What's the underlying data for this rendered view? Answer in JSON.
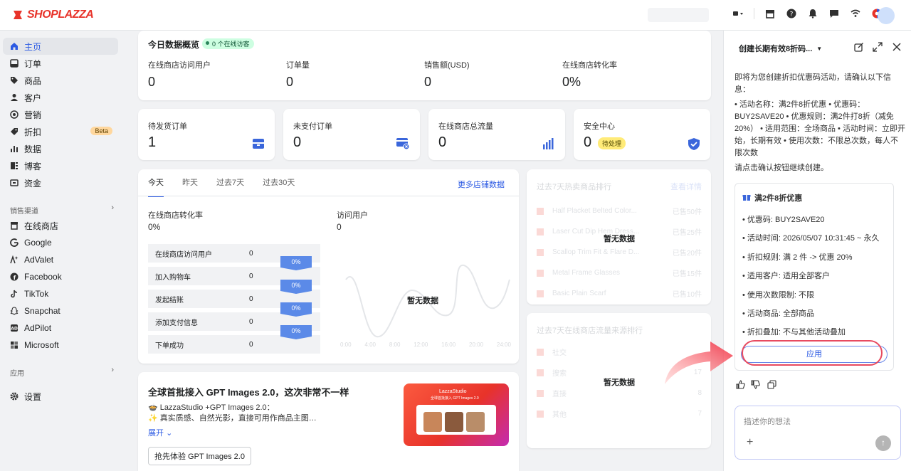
{
  "brand": {
    "name": "SHOPLAZZA"
  },
  "nav": {
    "items": [
      {
        "label": "主页"
      },
      {
        "label": "订单"
      },
      {
        "label": "商品"
      },
      {
        "label": "客户"
      },
      {
        "label": "营销"
      },
      {
        "label": "折扣",
        "badge": "Beta"
      },
      {
        "label": "数据"
      },
      {
        "label": "博客"
      },
      {
        "label": "资金"
      }
    ],
    "channels_label": "销售渠道",
    "channels": [
      {
        "label": "在线商店"
      },
      {
        "label": "Google"
      },
      {
        "label": "AdValet"
      },
      {
        "label": "Facebook"
      },
      {
        "label": "TikTok"
      },
      {
        "label": "Snapchat"
      },
      {
        "label": "AdPilot"
      },
      {
        "label": "Microsoft"
      }
    ],
    "apps_label": "应用",
    "settings_label": "设置"
  },
  "overview": {
    "title": "今日数据概览",
    "online_badge": "0 个在线访客",
    "metrics": [
      {
        "label": "在线商店访问用户",
        "value": "0"
      },
      {
        "label": "订单量",
        "value": "0"
      },
      {
        "label": "销售额(USD)",
        "value": "0"
      },
      {
        "label": "在线商店转化率",
        "value": "0%"
      }
    ]
  },
  "tiles": [
    {
      "label": "待发货订单",
      "value": "1"
    },
    {
      "label": "未支付订单",
      "value": "0"
    },
    {
      "label": "在线商店总流量",
      "value": "0"
    },
    {
      "label": "安全中心",
      "value": "0",
      "badge": "待处理"
    }
  ],
  "analytics": {
    "tabs": [
      "今天",
      "昨天",
      "过去7天",
      "过去30天"
    ],
    "more_link": "更多店铺数据",
    "conversion_label": "在线商店转化率",
    "conversion_value": "0%",
    "visitors_label": "访问用户",
    "visitors_value": "0",
    "funnel": [
      {
        "label": "在线商店访问用户",
        "value": "0"
      },
      {
        "label": "加入购物车",
        "value": "0"
      },
      {
        "label": "发起结账",
        "value": "0"
      },
      {
        "label": "添加支付信息",
        "value": "0"
      },
      {
        "label": "下单成功",
        "value": "0"
      }
    ],
    "funnel_pcts": [
      "0%",
      "0%",
      "0%",
      "0%"
    ],
    "no_data": "暂无数据",
    "x_ticks": [
      "0:00",
      "4:00",
      "8:00",
      "12:00",
      "16:00",
      "20:00",
      "24:00"
    ]
  },
  "hot_products": {
    "title": "过去7天热卖商品排行",
    "more": "查看详情",
    "no_data": "暂无数据",
    "items": [
      {
        "rank": "1",
        "name": "Half Placket Belted Color...",
        "sales": "已售50件"
      },
      {
        "rank": "2",
        "name": "Laser Cut Dip Hem Dress...",
        "sales": "已售25件"
      },
      {
        "rank": "3",
        "name": "Scallop Trim Fit & Flare D...",
        "sales": "已售20件"
      },
      {
        "rank": "4",
        "name": "Metal Frame Glasses",
        "sales": "已售15件"
      },
      {
        "rank": "5",
        "name": "Basic Plain Scarf",
        "sales": "已售10件"
      }
    ]
  },
  "traffic_sources": {
    "title": "过去7天在线商店流量来源排行",
    "no_data": "暂无数据",
    "items": [
      {
        "rank": "1",
        "name": "社交",
        "value": ""
      },
      {
        "rank": "2",
        "name": "搜索",
        "value": "17"
      },
      {
        "rank": "3",
        "name": "直接",
        "value": "8"
      },
      {
        "rank": "4",
        "name": "其他",
        "value": "7"
      }
    ]
  },
  "promo": {
    "title": "全球首批接入 GPT Images 2.0，这次非常不一样",
    "line1": "🍲 LazzaStudio +GPT Images 2.0：",
    "line2": "✨ 真实质感、自然光影，直接可用作商品主图…",
    "expand": "展开",
    "cta": "抢先体验 GPT Images 2.0",
    "banner_brand": "LazzaStudio",
    "banner_sub": "全球首批接入 GPT Images 2.0"
  },
  "assistant": {
    "title": "创建长期有效8折码...",
    "intro": "即将为您创建折扣优惠码活动，请确认以下信息：",
    "summary": "• 活动名称：满2件8折优惠 • 优惠码：BUY2SAVE20 • 优惠规则：满2件打8折（减免20%） • 适用范围：全场商品 • 活动时间：立即开始，长期有效 • 使用次数：不限总次数，每人不限次数",
    "confirm": "请点击确认按钮继续创建。",
    "card_title": "满2件8折优惠",
    "rows": [
      "优惠码:  BUY2SAVE20",
      "活动时间:  2026/05/07 10:31:45 ~ 永久",
      "折扣规则:  满 2 件 -> 优惠 20%",
      "适用客户:  适用全部客户",
      "使用次数限制:  不限",
      "活动商品:  全部商品",
      "折扣叠加:  不与其他活动叠加"
    ],
    "apply": "应用",
    "input_placeholder": "描述你的想法"
  },
  "colors": {
    "accent": "#2d5be3",
    "brand": "#e8332a",
    "highlight": "#e84a5f"
  }
}
